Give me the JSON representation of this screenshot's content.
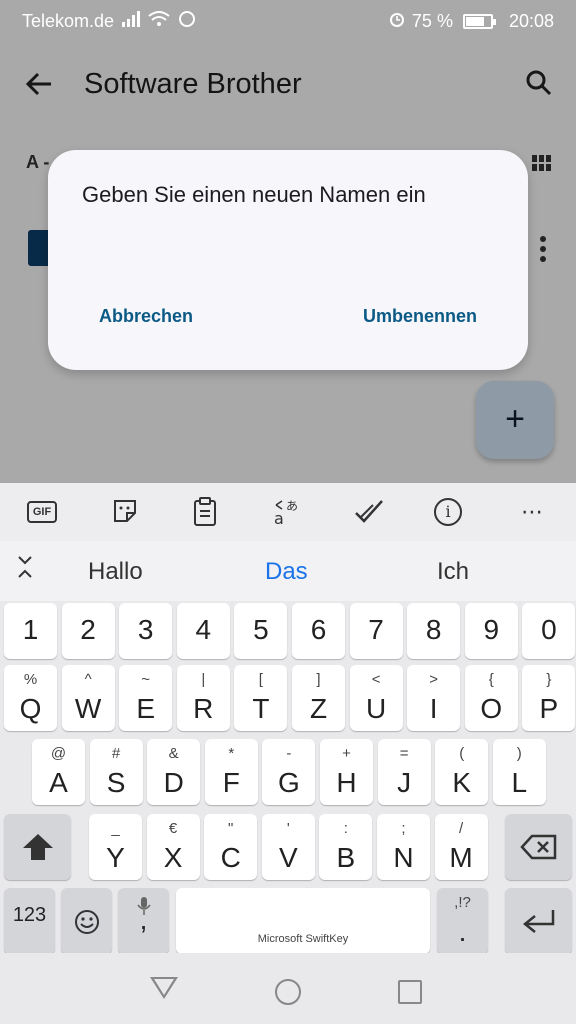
{
  "status_bar": {
    "carrier": "Telekom.de",
    "battery": "75 %",
    "battery_level": 0.75,
    "time": "20:08"
  },
  "toolbar": {
    "title": "Software Brother"
  },
  "list": {
    "sort_label": "A -"
  },
  "dialog": {
    "message": "Geben Sie einen neuen Namen ein",
    "cancel_label": "Abbrechen",
    "confirm_label": "Umbenennen"
  },
  "fab": {
    "label": "+"
  },
  "keyboard": {
    "toolbar": {
      "gif_label": "GIF"
    },
    "suggestions": [
      "Hallo",
      "Das",
      "Ich"
    ],
    "number_row": [
      "1",
      "2",
      "3",
      "4",
      "5",
      "6",
      "7",
      "8",
      "9",
      "0"
    ],
    "row1": [
      {
        "main": "Q",
        "sec": "%"
      },
      {
        "main": "W",
        "sec": "^"
      },
      {
        "main": "E",
        "sec": "~"
      },
      {
        "main": "R",
        "sec": "|"
      },
      {
        "main": "T",
        "sec": "["
      },
      {
        "main": "Z",
        "sec": "]"
      },
      {
        "main": "U",
        "sec": "<"
      },
      {
        "main": "I",
        "sec": ">"
      },
      {
        "main": "O",
        "sec": "{"
      },
      {
        "main": "P",
        "sec": "}"
      }
    ],
    "row2": [
      {
        "main": "A",
        "sec": "@"
      },
      {
        "main": "S",
        "sec": "#"
      },
      {
        "main": "D",
        "sec": "&"
      },
      {
        "main": "F",
        "sec": "*"
      },
      {
        "main": "G",
        "sec": "-"
      },
      {
        "main": "H",
        "sec": "+"
      },
      {
        "main": "J",
        "sec": "="
      },
      {
        "main": "K",
        "sec": "("
      },
      {
        "main": "L",
        "sec": ")"
      }
    ],
    "row3": [
      {
        "main": "Y",
        "sec": "_"
      },
      {
        "main": "X",
        "sec": "€"
      },
      {
        "main": "C",
        "sec": "\""
      },
      {
        "main": "V",
        "sec": "'"
      },
      {
        "main": "B",
        "sec": ":"
      },
      {
        "main": "N",
        "sec": ";"
      },
      {
        "main": "M",
        "sec": "/"
      }
    ],
    "bottom": {
      "numbers_label": "123",
      "comma": ",",
      "space_label": "Microsoft SwiftKey",
      "period": ".",
      "period_sec": ",!?"
    }
  }
}
